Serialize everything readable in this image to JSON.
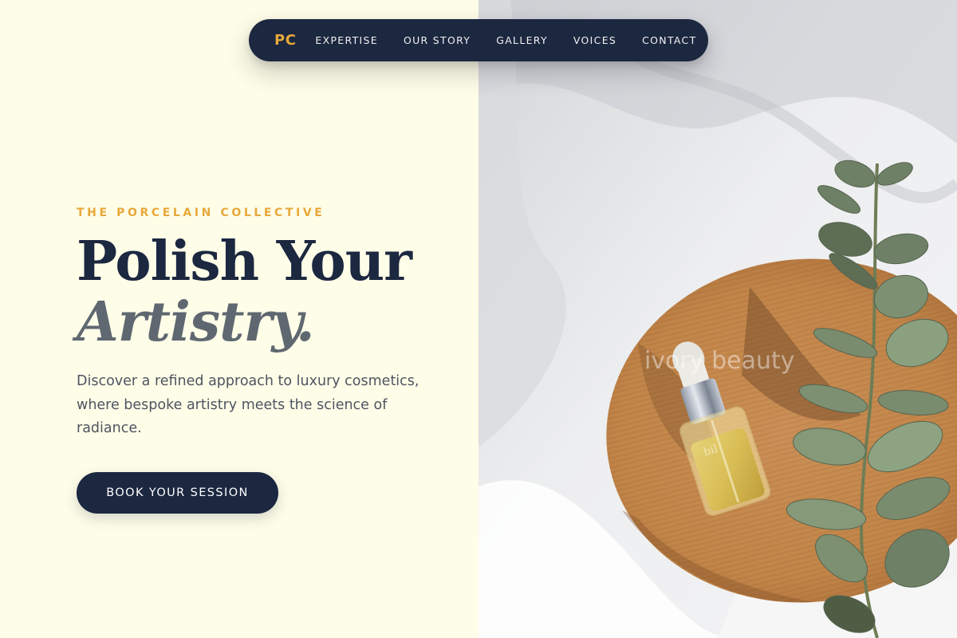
{
  "nav": {
    "logo": "PC",
    "items": [
      "EXPERTISE",
      "OUR STORY",
      "GALLERY",
      "VOICES",
      "CONTACT"
    ]
  },
  "hero": {
    "eyebrow": "THE PORCELAIN COLLECTIVE",
    "headline_line1": "Polish Your",
    "headline_line2": "Artistry.",
    "description": "Discover a refined approach to luxury cosmetics, where bespoke artistry meets the science of radiance.",
    "cta_label": "BOOK YOUR SESSION"
  },
  "image": {
    "watermark": "ivory beauty"
  },
  "colors": {
    "navy": "#1C2740",
    "accent": "#E8A83A",
    "background": "#FEFDE8",
    "italic_grey": "#5F6770"
  }
}
